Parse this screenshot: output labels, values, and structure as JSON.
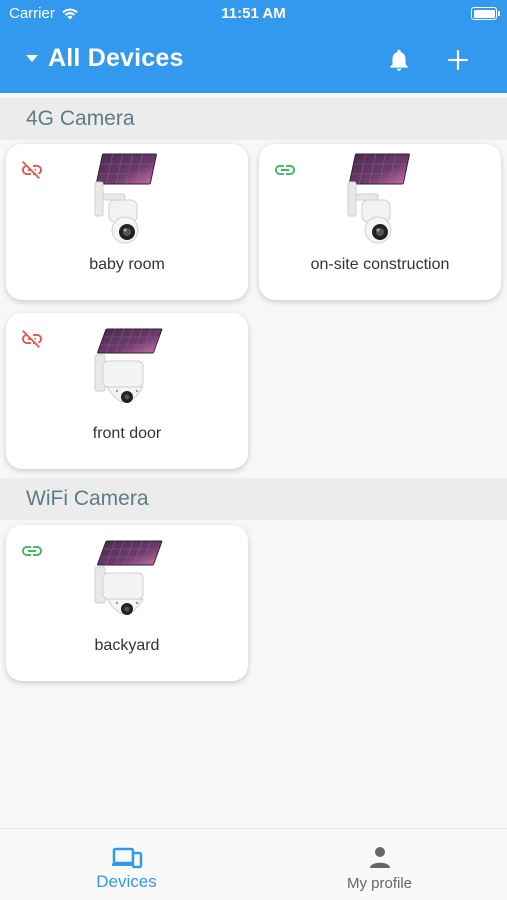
{
  "status_bar": {
    "carrier": "Carrier",
    "time": "11:51 AM"
  },
  "app_bar": {
    "title": "All Devices"
  },
  "sections": [
    {
      "title": "4G Camera",
      "devices": [
        {
          "name": "baby room",
          "status": "offline",
          "status_color": "#e05a4f",
          "icon": "link-off-icon"
        },
        {
          "name": "on-site construction",
          "status": "online",
          "status_color": "#3dbb5c",
          "icon": "link-icon"
        },
        {
          "name": "front door",
          "status": "offline",
          "status_color": "#e05a4f",
          "icon": "link-off-icon"
        }
      ]
    },
    {
      "title": "WiFi Camera",
      "devices": [
        {
          "name": "backyard",
          "status": "online",
          "status_color": "#3dbb5c",
          "icon": "link-icon"
        }
      ]
    }
  ],
  "bottom_nav": {
    "tabs": [
      {
        "label": "Devices",
        "icon": "devices-icon",
        "active": true
      },
      {
        "label": "My profile",
        "icon": "person-icon",
        "active": false
      }
    ]
  },
  "colors": {
    "primary": "#3399ee",
    "online": "#3dbb5c",
    "offline": "#e05a4f"
  }
}
